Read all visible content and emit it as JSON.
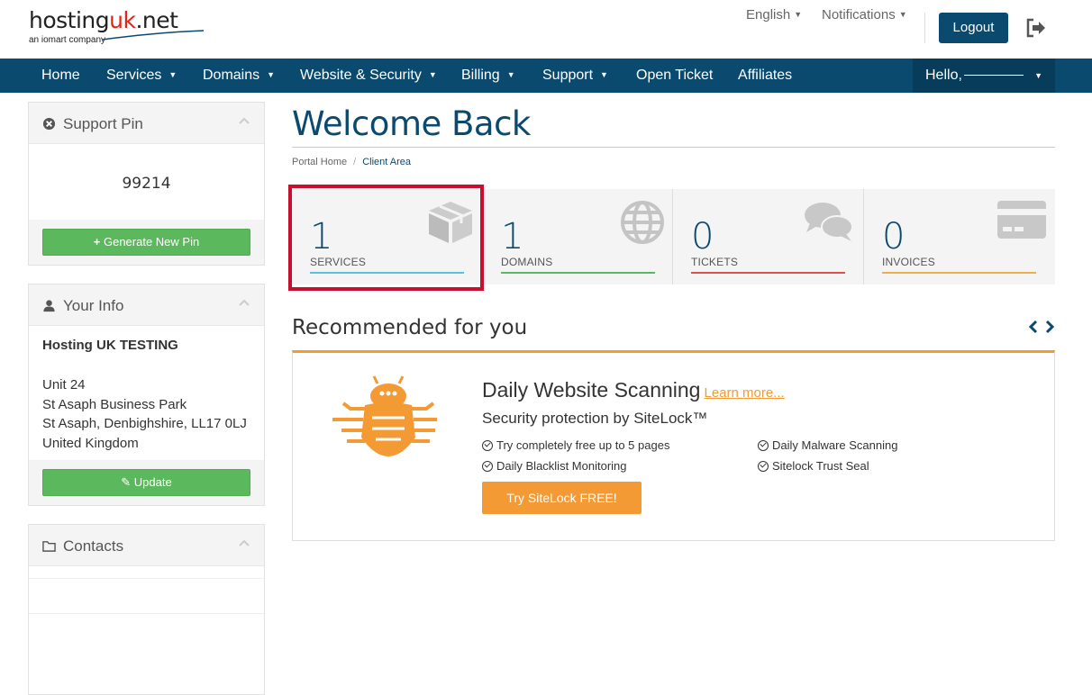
{
  "header": {
    "logo_text_prefix": "hosting",
    "logo_text_accent": "uk",
    "logo_text_suffix": ".net",
    "logo_tagline": "an iomart company",
    "language_label": "English",
    "notifications_label": "Notifications",
    "logout_label": "Logout"
  },
  "nav": {
    "items": [
      {
        "label": "Home",
        "dropdown": false
      },
      {
        "label": "Services",
        "dropdown": true
      },
      {
        "label": "Domains",
        "dropdown": true
      },
      {
        "label": "Website & Security",
        "dropdown": true
      },
      {
        "label": "Billing",
        "dropdown": true
      },
      {
        "label": "Support",
        "dropdown": true
      },
      {
        "label": "Open Ticket",
        "dropdown": false
      },
      {
        "label": "Affiliates",
        "dropdown": false
      }
    ],
    "hello_label": "Hello,"
  },
  "sidebar": {
    "support_pin": {
      "title": "Support Pin",
      "pin": "99214",
      "button": "Generate New Pin"
    },
    "your_info": {
      "title": "Your Info",
      "name": "Hosting UK TESTING",
      "address_lines": [
        "Unit 24",
        "St Asaph Business Park",
        "St Asaph, Denbighshire, LL17 0LJ",
        "United Kingdom"
      ],
      "button": "Update"
    },
    "contacts": {
      "title": "Contacts"
    }
  },
  "main": {
    "title": "Welcome Back",
    "breadcrumb": {
      "home": "Portal Home",
      "separator": "/",
      "current": "Client Area"
    },
    "tiles": [
      {
        "count": "1",
        "label": "SERVICES",
        "color": "#5bc0de",
        "icon": "box-icon"
      },
      {
        "count": "1",
        "label": "DOMAINS",
        "color": "#5cb85c",
        "icon": "globe-icon"
      },
      {
        "count": "0",
        "label": "TICKETS",
        "color": "#d9534f",
        "icon": "comments-icon"
      },
      {
        "count": "0",
        "label": "INVOICES",
        "color": "#f0ad4e",
        "icon": "credit-card-icon"
      }
    ],
    "recommended": {
      "title": "Recommended for you",
      "product_title": "Daily Website Scanning",
      "learn_more": "Learn more...",
      "subtitle": "Security protection by SiteLock™",
      "features": [
        "Try completely free up to 5 pages",
        "Daily Malware Scanning",
        "Daily Blacklist Monitoring",
        "Sitelock Trust Seal"
      ],
      "cta": "Try SiteLock FREE!"
    }
  },
  "colors": {
    "brand_navy": "#0b4a6f",
    "accent_orange": "#f39a34",
    "success_green": "#5cb85c",
    "highlight_red": "#c8102e"
  }
}
